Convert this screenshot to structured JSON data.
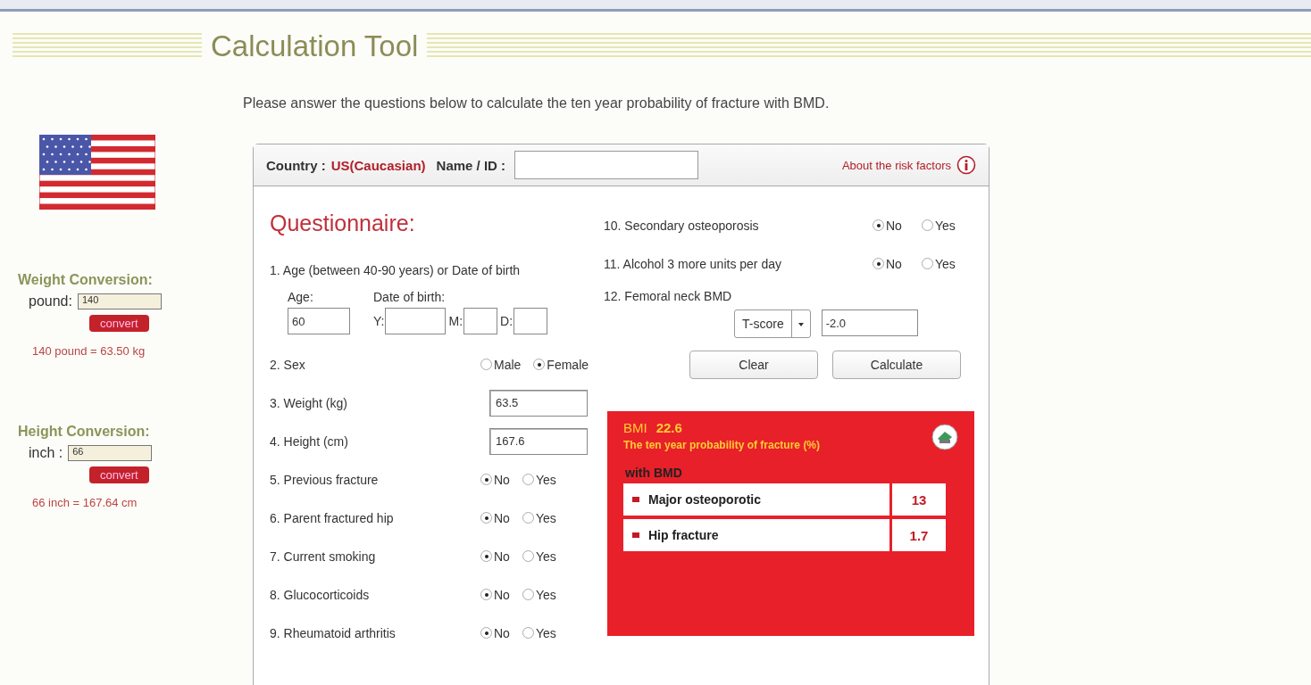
{
  "header": {
    "title": "Calculation Tool"
  },
  "intro": "Please answer the questions below to calculate the ten year probability of fracture with BMD.",
  "sidebar": {
    "conversions": [
      {
        "title": "Weight Conversion:",
        "label": "pound:",
        "value": "140",
        "button": "convert",
        "result": "140 pound = 63.50 kg"
      },
      {
        "title": "Height Conversion:",
        "label": "inch :",
        "value": "66",
        "button": "convert",
        "result": "66 inch = 167.64 cm"
      }
    ]
  },
  "form": {
    "country_label": "Country :",
    "country": "US(Caucasian)",
    "name_label": "Name / ID :",
    "about_link": "About the risk factors",
    "questionnaire_title": "Questionnaire:",
    "left_questions": [
      {
        "kind": "age",
        "label": "1. Age (between 40-90 years) or Date of birth",
        "age_label": "Age:",
        "age_value": "60",
        "dob_label": "Date of birth:",
        "parts": [
          "Y:",
          "M:",
          "D:"
        ]
      },
      {
        "kind": "choice",
        "label": "2. Sex",
        "options": [
          {
            "label": "Male",
            "selected": false
          },
          {
            "label": "Female",
            "selected": true
          }
        ]
      },
      {
        "kind": "number",
        "label": "3. Weight (kg)",
        "value": "63.5"
      },
      {
        "kind": "number",
        "label": "4. Height (cm)",
        "value": "167.6"
      },
      {
        "kind": "choice",
        "label": "5. Previous fracture",
        "options": [
          {
            "label": "No",
            "selected": true
          },
          {
            "label": "Yes",
            "selected": false
          }
        ]
      },
      {
        "kind": "choice",
        "label": "6. Parent fractured hip",
        "options": [
          {
            "label": "No",
            "selected": true
          },
          {
            "label": "Yes",
            "selected": false
          }
        ]
      },
      {
        "kind": "choice",
        "label": "7. Current smoking",
        "options": [
          {
            "label": "No",
            "selected": true
          },
          {
            "label": "Yes",
            "selected": false
          }
        ]
      },
      {
        "kind": "choice",
        "label": "8. Glucocorticoids",
        "options": [
          {
            "label": "No",
            "selected": true
          },
          {
            "label": "Yes",
            "selected": false
          }
        ]
      },
      {
        "kind": "choice",
        "label": "9. Rheumatoid arthritis",
        "options": [
          {
            "label": "No",
            "selected": true
          },
          {
            "label": "Yes",
            "selected": false
          }
        ]
      }
    ],
    "right_questions": [
      {
        "kind": "choice",
        "label": "10. Secondary osteoporosis",
        "options": [
          {
            "label": "No",
            "selected": true
          },
          {
            "label": "Yes",
            "selected": false
          }
        ]
      },
      {
        "kind": "choice",
        "label": "11. Alcohol 3 more units per day",
        "options": [
          {
            "label": "No",
            "selected": true
          },
          {
            "label": "Yes",
            "selected": false
          }
        ]
      },
      {
        "kind": "bmd",
        "label": "12. Femoral neck BMD",
        "select": "T-score",
        "value": "-2.0"
      }
    ],
    "buttons": [
      "Clear",
      "Calculate"
    ],
    "result": {
      "bmi_label": "BMI",
      "bmi_value": "22.6",
      "subtitle": "The ten year probability of fracture (%)",
      "section": "with BMD",
      "rows": [
        {
          "label": "Major osteoporotic",
          "value": "13"
        },
        {
          "label": "Hip fracture",
          "value": "1.7"
        }
      ]
    }
  }
}
